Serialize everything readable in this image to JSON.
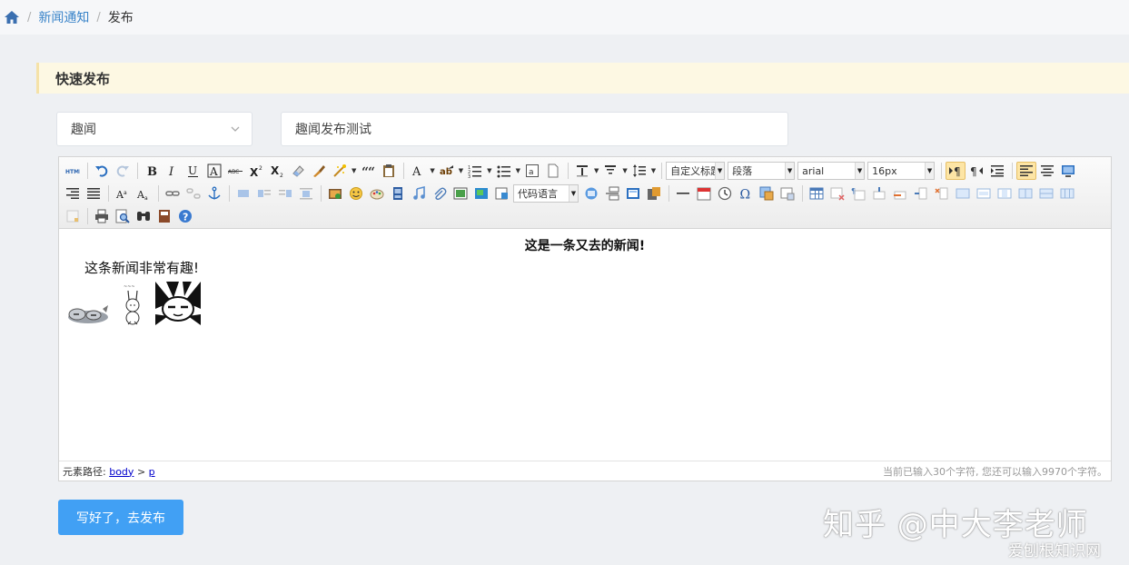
{
  "breadcrumb": {
    "home_icon": "home-icon",
    "items": [
      "新闻通知",
      "发布"
    ]
  },
  "section": {
    "title": "快速发布"
  },
  "form": {
    "category": {
      "value": "趣闻"
    },
    "title": {
      "value": "趣闻发布测试"
    },
    "submit_label": "写好了，去发布"
  },
  "editor": {
    "combos": {
      "custom_heading": "自定义标题",
      "paragraph": "段落",
      "font_family": "arial",
      "font_size": "16px",
      "code_language": "代码语言"
    },
    "content": {
      "heading": "这是一条又去的新闻!",
      "paragraph": "这条新闻非常有趣!"
    },
    "status": {
      "path_label": "元素路径:",
      "path_body": "body",
      "path_sep": ">",
      "path_p": "p",
      "char_count": "当前已输入30个字符, 您还可以输入9970个字符。"
    }
  },
  "watermark": {
    "main": "知乎 @中大李老师",
    "sub": "爱刨根知识网"
  },
  "colors": {
    "accent": "#41a0f4",
    "link": "#3a84c9",
    "section_bg": "#fdf8e3"
  }
}
